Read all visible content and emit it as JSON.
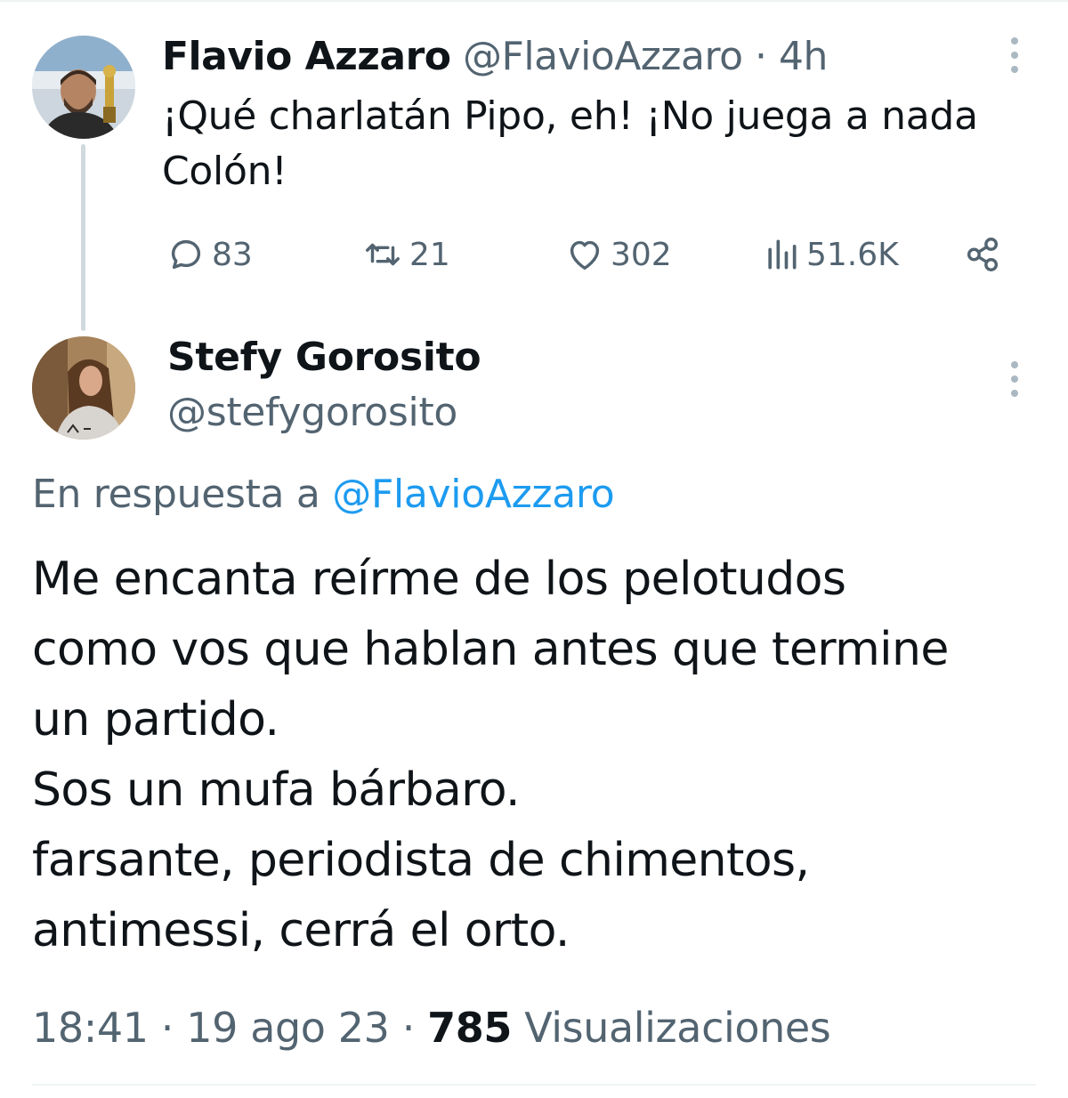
{
  "parent_tweet": {
    "author_name": "Flavio Azzaro",
    "author_handle": "@FlavioAzzaro",
    "separator": "·",
    "time": "4h",
    "text": "¡Qué charlatán Pipo, eh! ¡No juega a nada\nColón!",
    "actions": {
      "replies": "83",
      "retweets": "21",
      "likes": "302",
      "views": "51.6K"
    },
    "icons": [
      "reply-icon",
      "retweet-icon",
      "like-icon",
      "views-icon",
      "share-icon",
      "more-options-icon"
    ]
  },
  "reply_tweet": {
    "author_name": "Stefy Gorosito",
    "author_handle": "@stefygorosito",
    "reply_to_label": "En respuesta a",
    "reply_to_handle": "@FlavioAzzaro",
    "text": "Me encanta reírme de los pelotudos\ncomo vos que hablan antes que termine\nun partido.\nSos un mufa bárbaro.\nfarsante, periodista de chimentos,\nantimessi, cerrá el orto.",
    "time": "18:41",
    "date": "19 ago 23",
    "views_count": "785",
    "views_label": "Visualizaciones"
  },
  "colors": {
    "text": "#0f1419",
    "muted": "#536471",
    "link": "#1d9bf0",
    "thread_line": "#cfd9de",
    "divider": "#eff3f4"
  }
}
